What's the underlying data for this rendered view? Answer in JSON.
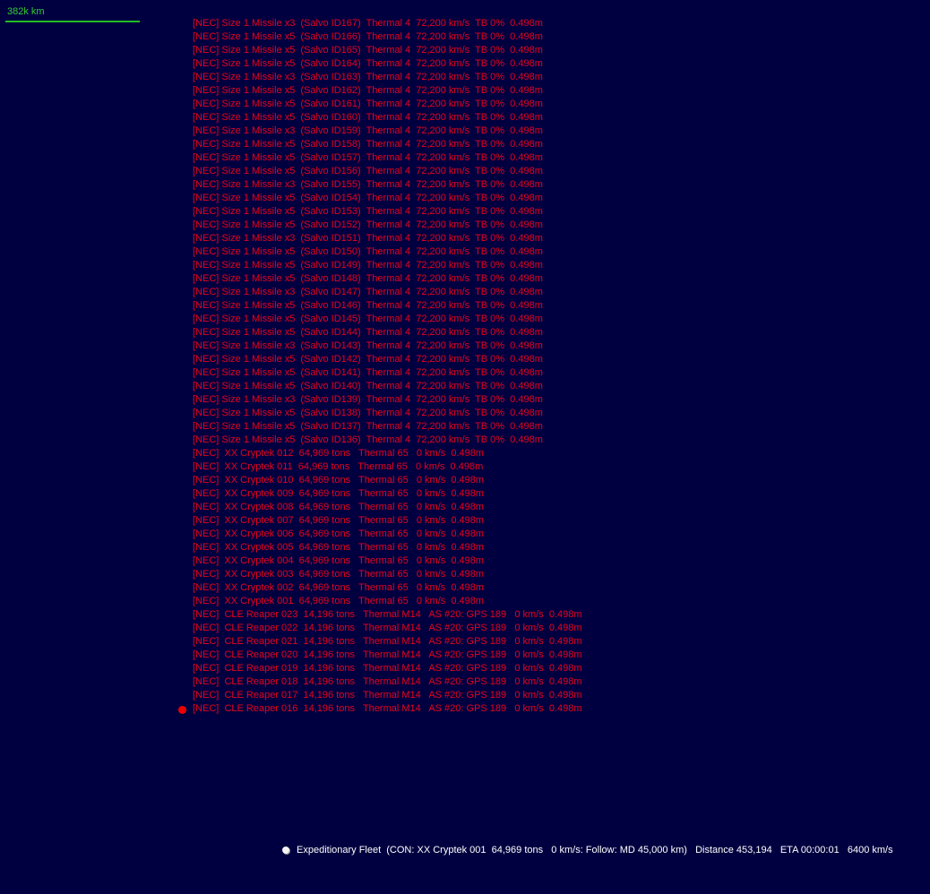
{
  "colors": {
    "background": "#000040",
    "hostile": "#e8001c",
    "hostile_marker": "#ee0000",
    "friendly": "#ffffff",
    "scale": "#33cc33"
  },
  "scale": {
    "label": "382k km"
  },
  "contacts": [
    "[NEC] Size 1 Missile x3  (Salvo ID167)  Thermal 4  72,200 km/s  TB 0%  0.498m",
    "[NEC] Size 1 Missile x5  (Salvo ID166)  Thermal 4  72,200 km/s  TB 0%  0.498m",
    "[NEC] Size 1 Missile x5  (Salvo ID165)  Thermal 4  72,200 km/s  TB 0%  0.498m",
    "[NEC] Size 1 Missile x5  (Salvo ID164)  Thermal 4  72,200 km/s  TB 0%  0.498m",
    "[NEC] Size 1 Missile x3  (Salvo ID163)  Thermal 4  72,200 km/s  TB 0%  0.498m",
    "[NEC] Size 1 Missile x5  (Salvo ID162)  Thermal 4  72,200 km/s  TB 0%  0.498m",
    "[NEC] Size 1 Missile x5  (Salvo ID161)  Thermal 4  72,200 km/s  TB 0%  0.498m",
    "[NEC] Size 1 Missile x5  (Salvo ID160)  Thermal 4  72,200 km/s  TB 0%  0.498m",
    "[NEC] Size 1 Missile x3  (Salvo ID159)  Thermal 4  72,200 km/s  TB 0%  0.498m",
    "[NEC] Size 1 Missile x5  (Salvo ID158)  Thermal 4  72,200 km/s  TB 0%  0.498m",
    "[NEC] Size 1 Missile x5  (Salvo ID157)  Thermal 4  72,200 km/s  TB 0%  0.498m",
    "[NEC] Size 1 Missile x5  (Salvo ID156)  Thermal 4  72,200 km/s  TB 0%  0.498m",
    "[NEC] Size 1 Missile x3  (Salvo ID155)  Thermal 4  72,200 km/s  TB 0%  0.498m",
    "[NEC] Size 1 Missile x5  (Salvo ID154)  Thermal 4  72,200 km/s  TB 0%  0.498m",
    "[NEC] Size 1 Missile x5  (Salvo ID153)  Thermal 4  72,200 km/s  TB 0%  0.498m",
    "[NEC] Size 1 Missile x5  (Salvo ID152)  Thermal 4  72,200 km/s  TB 0%  0.498m",
    "[NEC] Size 1 Missile x3  (Salvo ID151)  Thermal 4  72,200 km/s  TB 0%  0.498m",
    "[NEC] Size 1 Missile x5  (Salvo ID150)  Thermal 4  72,200 km/s  TB 0%  0.498m",
    "[NEC] Size 1 Missile x5  (Salvo ID149)  Thermal 4  72,200 km/s  TB 0%  0.498m",
    "[NEC] Size 1 Missile x5  (Salvo ID148)  Thermal 4  72,200 km/s  TB 0%  0.498m",
    "[NEC] Size 1 Missile x3  (Salvo ID147)  Thermal 4  72,200 km/s  TB 0%  0.498m",
    "[NEC] Size 1 Missile x5  (Salvo ID146)  Thermal 4  72,200 km/s  TB 0%  0.498m",
    "[NEC] Size 1 Missile x5  (Salvo ID145)  Thermal 4  72,200 km/s  TB 0%  0.498m",
    "[NEC] Size 1 Missile x5  (Salvo ID144)  Thermal 4  72,200 km/s  TB 0%  0.498m",
    "[NEC] Size 1 Missile x3  (Salvo ID143)  Thermal 4  72,200 km/s  TB 0%  0.498m",
    "[NEC] Size 1 Missile x5  (Salvo ID142)  Thermal 4  72,200 km/s  TB 0%  0.498m",
    "[NEC] Size 1 Missile x5  (Salvo ID141)  Thermal 4  72,200 km/s  TB 0%  0.498m",
    "[NEC] Size 1 Missile x5  (Salvo ID140)  Thermal 4  72,200 km/s  TB 0%  0.498m",
    "[NEC] Size 1 Missile x3  (Salvo ID139)  Thermal 4  72,200 km/s  TB 0%  0.498m",
    "[NEC] Size 1 Missile x5  (Salvo ID138)  Thermal 4  72,200 km/s  TB 0%  0.498m",
    "[NEC] Size 1 Missile x5  (Salvo ID137)  Thermal 4  72,200 km/s  TB 0%  0.498m",
    "[NEC] Size 1 Missile x5  (Salvo ID136)  Thermal 4  72,200 km/s  TB 0%  0.498m",
    "[NEC]  XX Cryptek 012  64,969 tons   Thermal 65   0 km/s  0.498m",
    "[NEC]  XX Cryptek 011  64,969 tons   Thermal 65   0 km/s  0.498m",
    "[NEC]  XX Cryptek 010  64,969 tons   Thermal 65   0 km/s  0.498m",
    "[NEC]  XX Cryptek 009  64,969 tons   Thermal 65   0 km/s  0.498m",
    "[NEC]  XX Cryptek 008  64,969 tons   Thermal 65   0 km/s  0.498m",
    "[NEC]  XX Cryptek 007  64,969 tons   Thermal 65   0 km/s  0.498m",
    "[NEC]  XX Cryptek 006  64,969 tons   Thermal 65   0 km/s  0.498m",
    "[NEC]  XX Cryptek 005  64,969 tons   Thermal 65   0 km/s  0.498m",
    "[NEC]  XX Cryptek 004  64,969 tons   Thermal 65   0 km/s  0.498m",
    "[NEC]  XX Cryptek 003  64,969 tons   Thermal 65   0 km/s  0.498m",
    "[NEC]  XX Cryptek 002  64,969 tons   Thermal 65   0 km/s  0.498m",
    "[NEC]  XX Cryptek 001  64,969 tons   Thermal 65   0 km/s  0.498m",
    "[NEC]  CLE Reaper 023  14,196 tons   Thermal M14   AS #20: GPS 189   0 km/s  0.498m",
    "[NEC]  CLE Reaper 022  14,196 tons   Thermal M14   AS #20: GPS 189   0 km/s  0.498m",
    "[NEC]  CLE Reaper 021  14,196 tons   Thermal M14   AS #20: GPS 189   0 km/s  0.498m",
    "[NEC]  CLE Reaper 020  14,196 tons   Thermal M14   AS #20: GPS 189   0 km/s  0.498m",
    "[NEC]  CLE Reaper 019  14,196 tons   Thermal M14   AS #20: GPS 189   0 km/s  0.498m",
    "[NEC]  CLE Reaper 018  14,196 tons   Thermal M14   AS #20: GPS 189   0 km/s  0.498m",
    "[NEC]  CLE Reaper 017  14,196 tons   Thermal M14   AS #20: GPS 189   0 km/s  0.498m",
    "[NEC]  CLE Reaper 016  14,196 tons   Thermal M14   AS #20: GPS 189   0 km/s  0.498m"
  ],
  "fleet": {
    "label": "Expeditionary Fleet  (CON: XX Cryptek 001  64,969 tons   0 km/s: Follow: MD 45,000 km)   Distance 453,194   ETA 00:00:01   6400 km/s"
  }
}
